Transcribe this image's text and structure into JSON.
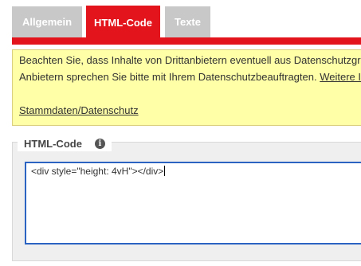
{
  "tabs": {
    "allgemein": "Allgemein",
    "html_code": "HTML-Code",
    "texte": "Texte"
  },
  "notice": {
    "line1": "Beachten Sie, dass Inhalte von Drittanbietern eventuell aus Datenschutzgrü",
    "line2": "Anbietern sprechen Sie bitte mit Ihrem Datenschutzbeauftragten.",
    "line2_link": "Weitere I",
    "link": "Stammdaten/Datenschutz"
  },
  "html_code_section": {
    "legend": "HTML-Code",
    "info_icon": "info-icon",
    "code_value": "<div style=\"height: 4vH\"></div>"
  },
  "colors": {
    "accent": "#e3141b",
    "inactive_tab": "#c8c8c8",
    "notice_bg": "#ffffa8",
    "focus_border": "#2b63c2"
  }
}
